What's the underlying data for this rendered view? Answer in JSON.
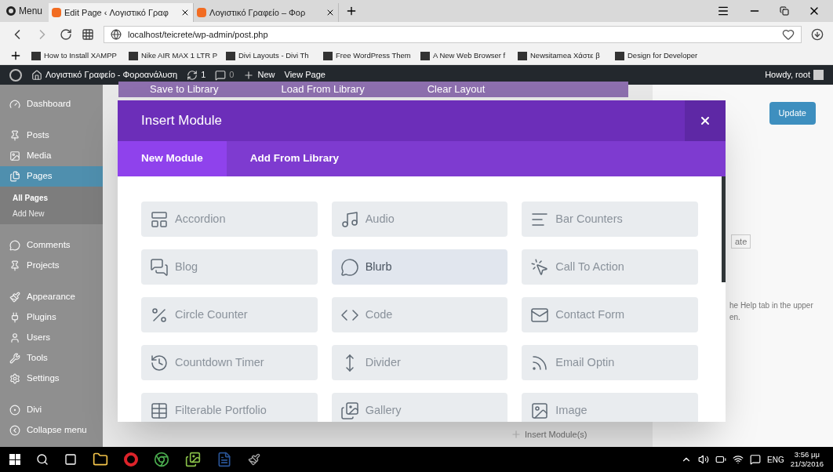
{
  "browser": {
    "menu_label": "Menu",
    "tabs": [
      {
        "title": "Edit Page ‹ Λογιστικό Γραφ",
        "selected": true
      },
      {
        "title": "Λογιστικό Γραφείο – Φορ",
        "selected": false
      }
    ],
    "address": "localhost/teicrete/wp-admin/post.php",
    "bookmarks": [
      "How to Install XAMPP",
      "Nike AIR MAX 1 LTR P",
      "Divi Layouts - Divi Th",
      "Free WordPress Them",
      "A New Web Browser f",
      "Newsitamea Χάστε β",
      "Design for Developer"
    ]
  },
  "admin_bar": {
    "site": "Λογιστικό Γραφείο - Φοροανάλυση",
    "updates": "1",
    "comments": "0",
    "new": "New",
    "view": "View Page",
    "howdy": "Howdy, root"
  },
  "sidebar": {
    "items": [
      {
        "label": "Dashboard",
        "selected": false
      },
      {
        "label": "Posts",
        "selected": false
      },
      {
        "label": "Media",
        "selected": false
      },
      {
        "label": "Pages",
        "selected": true,
        "children": [
          {
            "label": "All Pages",
            "selected": true
          },
          {
            "label": "Add New",
            "selected": false
          }
        ]
      },
      {
        "label": "Comments",
        "selected": false
      },
      {
        "label": "Projects",
        "selected": false
      },
      {
        "label": "Appearance",
        "selected": false
      },
      {
        "label": "Plugins",
        "selected": false
      },
      {
        "label": "Users",
        "selected": false
      },
      {
        "label": "Tools",
        "selected": false
      },
      {
        "label": "Settings",
        "selected": false
      },
      {
        "label": "Divi",
        "selected": false
      },
      {
        "label": "Collapse menu",
        "selected": false
      }
    ]
  },
  "builder_toolbar": [
    "Save to Library",
    "Load From Library",
    "Clear Layout"
  ],
  "publish": {
    "button": "Update",
    "select_fragment": "ate",
    "help_lines": [
      "he Help tab in the upper",
      "en."
    ]
  },
  "insert_modules_label": "Insert Module(s)",
  "modal": {
    "title": "Insert Module",
    "tabs": [
      {
        "label": "New Module",
        "selected": true
      },
      {
        "label": "Add From Library",
        "selected": false
      }
    ],
    "modules": [
      {
        "label": "Accordion",
        "hovered": false
      },
      {
        "label": "Audio",
        "hovered": false
      },
      {
        "label": "Bar Counters",
        "hovered": false
      },
      {
        "label": "Blog",
        "hovered": false
      },
      {
        "label": "Blurb",
        "hovered": true
      },
      {
        "label": "Call To Action",
        "hovered": false
      },
      {
        "label": "Circle Counter",
        "hovered": false
      },
      {
        "label": "Code",
        "hovered": false
      },
      {
        "label": "Contact Form",
        "hovered": false
      },
      {
        "label": "Countdown Timer",
        "hovered": false
      },
      {
        "label": "Divider",
        "hovered": false
      },
      {
        "label": "Email Optin",
        "hovered": false
      },
      {
        "label": "Filterable Portfolio",
        "hovered": false
      },
      {
        "label": "Gallery",
        "hovered": false
      },
      {
        "label": "Image",
        "hovered": false
      }
    ]
  },
  "taskbar": {
    "language": "ENG",
    "time": "3:56 μμ",
    "date": "21/3/2016"
  }
}
